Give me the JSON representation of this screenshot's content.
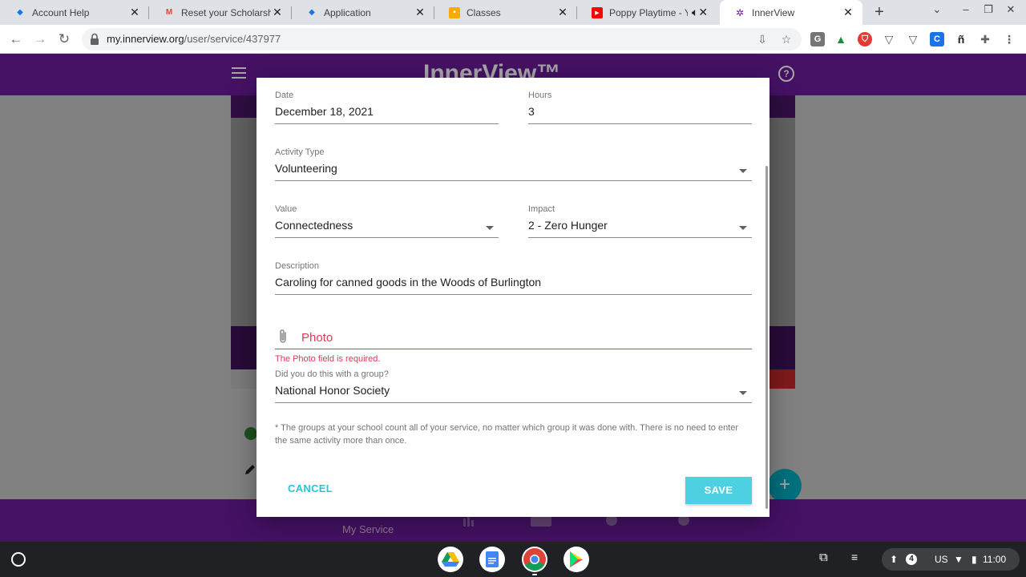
{
  "browser": {
    "tabs": [
      {
        "title": "Account Help",
        "favicon": "diamond-icon",
        "color": "#1a73e8"
      },
      {
        "title": "Reset your Scholarship",
        "favicon": "gmail-icon",
        "color": "#ea4335"
      },
      {
        "title": "Application",
        "favicon": "diamond-icon",
        "color": "#1a73e8"
      },
      {
        "title": "Classes",
        "favicon": "classroom-icon",
        "color": "#f9ab00"
      },
      {
        "title": "Poppy Playtime - Y",
        "favicon": "youtube-icon",
        "color": "#ff0000"
      },
      {
        "title": "InnerView",
        "favicon": "innerview-icon",
        "color": "#6a1b9a",
        "active": true
      }
    ],
    "url_host": "my.innerview.org",
    "url_path": "/user/service/437977"
  },
  "app": {
    "brand": "InnerView™",
    "bottom_nav": {
      "my_service": "My Service"
    },
    "accent": "#6a1b9a"
  },
  "form": {
    "date": {
      "label": "Date",
      "value": "December 18, 2021"
    },
    "hours": {
      "label": "Hours",
      "value": "3"
    },
    "activity_type": {
      "label": "Activity Type",
      "value": "Volunteering"
    },
    "value_field": {
      "label": "Value",
      "value": "Connectedness"
    },
    "impact": {
      "label": "Impact",
      "value": "2 - Zero Hunger"
    },
    "description": {
      "label": "Description",
      "value": "Caroling for canned goods in the Woods of Burlington"
    },
    "photo": {
      "label": "Photo",
      "error": "The Photo field is required."
    },
    "group": {
      "label": "Did you do this with a group?",
      "value": "National Honor Society"
    },
    "note": "* The groups at your school count all of your service, no matter which group it was done with. There is no need to enter the same activity more than once.",
    "cancel_label": "CANCEL",
    "save_label": "SAVE"
  },
  "shelf": {
    "notification_count": "4",
    "locale": "US",
    "time": "11:00"
  }
}
